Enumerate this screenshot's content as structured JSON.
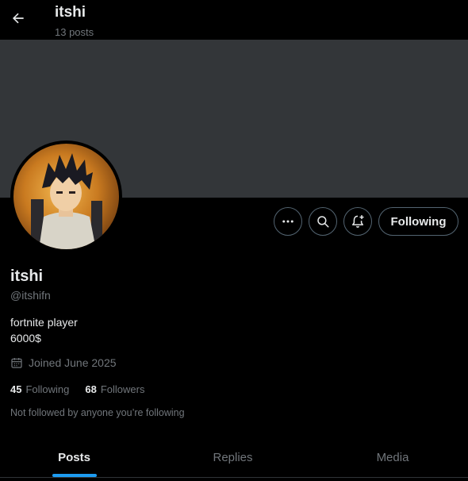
{
  "header": {
    "title": "itshi",
    "posts_count": "13 posts",
    "back_icon": "arrow-left-icon"
  },
  "profile": {
    "display_name": "itshi",
    "handle": "@itshifn",
    "bio_lines": [
      "fortnite player",
      "6000$"
    ],
    "joined": "Joined June 2025",
    "following_count": "45",
    "following_label": "Following",
    "followers_count": "68",
    "followers_label": "Followers",
    "not_followed_note": "Not followed by anyone you’re following"
  },
  "actions": {
    "more_icon": "more-icon",
    "search_icon": "search-icon",
    "notify_icon": "bell-plus-icon",
    "following_button": "Following"
  },
  "tabs": [
    {
      "label": "Posts",
      "active": true
    },
    {
      "label": "Replies",
      "active": false
    },
    {
      "label": "Media",
      "active": false
    }
  ],
  "colors": {
    "background": "#000000",
    "banner": "#333639",
    "accent": "#1d9bf0",
    "secondary_text": "#71767b",
    "border": "#536471"
  }
}
